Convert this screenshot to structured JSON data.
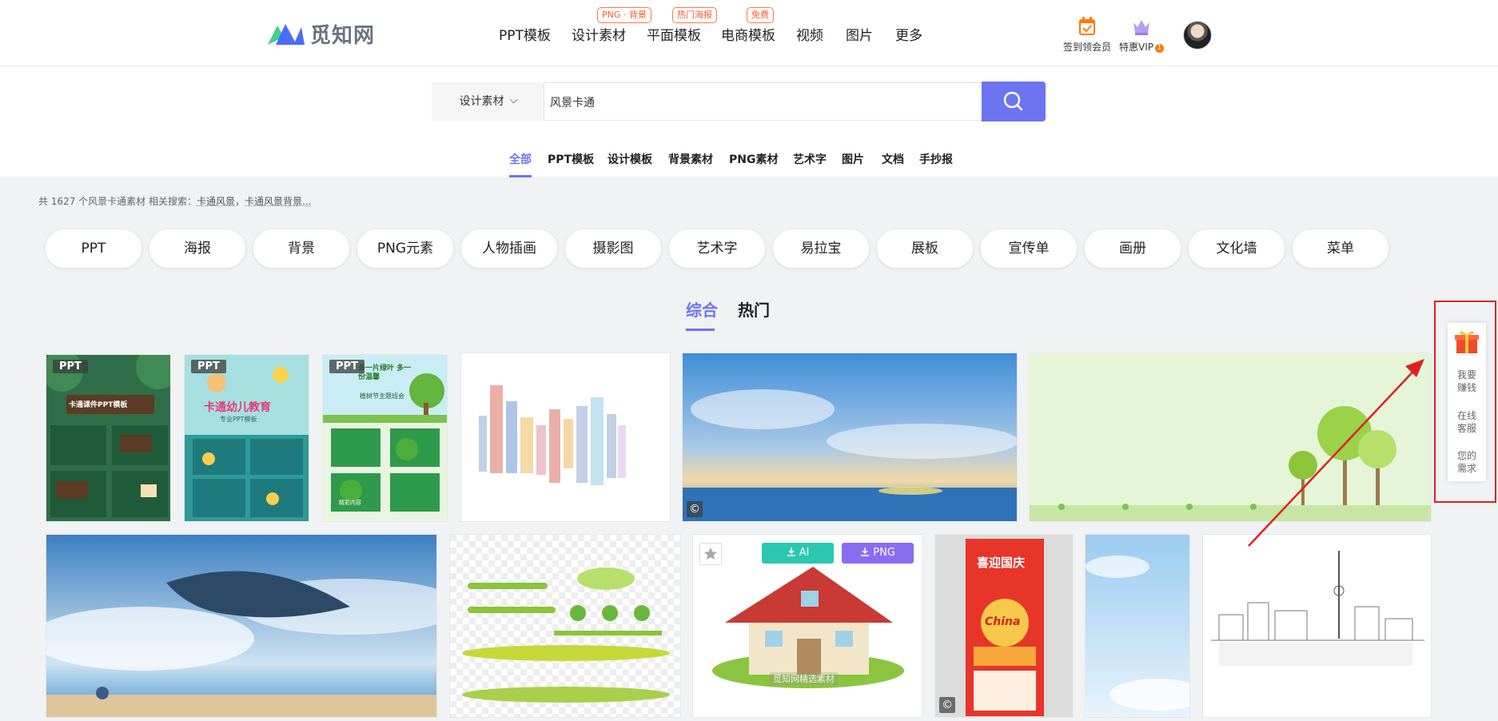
{
  "header": {
    "logo_text": "觅知网",
    "nav": [
      {
        "label": "PPT模板",
        "badge": ""
      },
      {
        "label": "设计素材",
        "badge": "PNG · 背景"
      },
      {
        "label": "平面模板",
        "badge": "热门海报"
      },
      {
        "label": "电商模板",
        "badge": "免费"
      },
      {
        "label": "视频",
        "badge": ""
      },
      {
        "label": "图片",
        "badge": ""
      },
      {
        "label": "更多",
        "badge": ""
      }
    ],
    "checkin_label": "签到领会员",
    "vip_label": "特惠VIP",
    "vip_count": "1",
    "colors": {
      "accent": "#6c74f0",
      "badge": "#ff5a2b",
      "logo_green": "#3fcf8e",
      "logo_blue": "#4a6cf7"
    }
  },
  "search": {
    "category": "设计素材",
    "value": "风景卡通",
    "placeholder": "风景卡通",
    "button_icon": "search-icon"
  },
  "sub_tabs": [
    "全部",
    "PPT模板",
    "设计模板",
    "背景素材",
    "PNG素材",
    "艺术字",
    "图片",
    "文档",
    "手抄报"
  ],
  "active_sub_tab": "全部",
  "result_info": {
    "prefix": "共 1627 个风景卡通素材 相关搜索：",
    "related": [
      "卡通风景",
      "卡通风景背景..."
    ],
    "sep": "，"
  },
  "chips": [
    "PPT",
    "海报",
    "背景",
    "PNG元素",
    "人物插画",
    "摄影图",
    "艺术字",
    "易拉宝",
    "展板",
    "宣传单",
    "画册",
    "文化墙",
    "菜单"
  ],
  "sort_tabs": [
    "综合",
    "热门"
  ],
  "active_sort": "综合",
  "grid": {
    "ppt_tag": "PPT",
    "copyright_mark": "©",
    "card1_text": "卡通课件PPT模板",
    "card2_title": "卡通幼儿教育",
    "card2_sub": "专业PPT模板",
    "card3_title": "多一片绿叶 多一份温馨",
    "card3_sub": "植树节主题班会",
    "card3_footer": "精彩内容",
    "ai_label": "AI",
    "png_label": "PNG",
    "poster_title": "喜迎国庆",
    "poster_sub": "China",
    "watermark": "觅知网精选素材"
  },
  "float_panel": {
    "items": [
      "我要赚钱",
      "在线客服",
      "您的需求"
    ],
    "gift_icon": "gift-icon"
  }
}
